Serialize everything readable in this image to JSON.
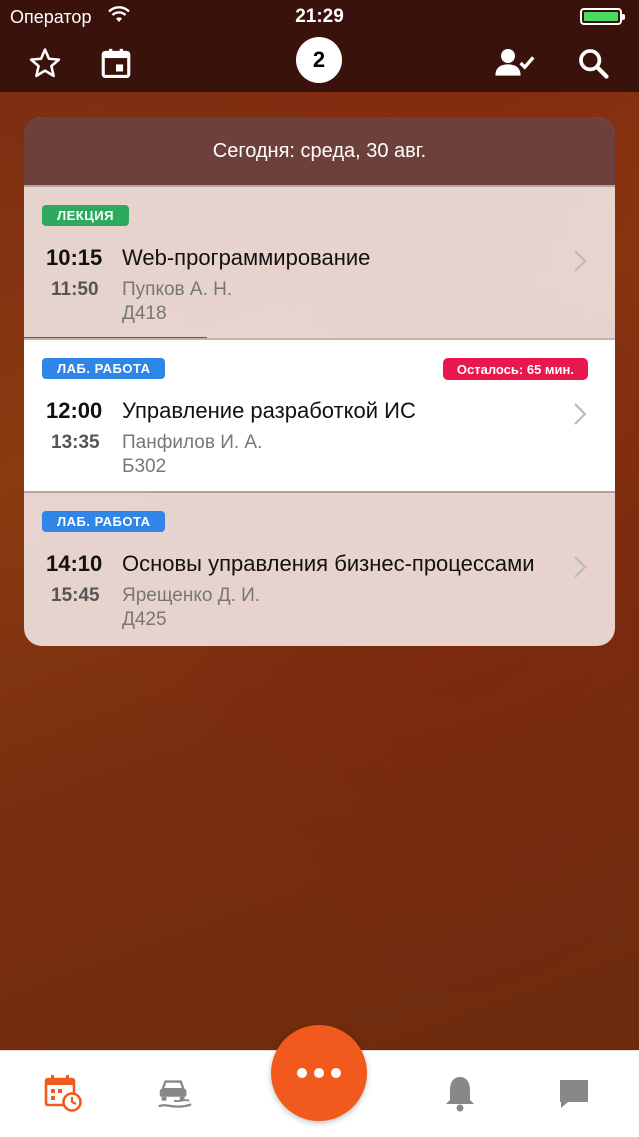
{
  "status_bar": {
    "carrier": "Оператор",
    "time": "21:29"
  },
  "top_nav": {
    "badge_count": "2"
  },
  "header": {
    "today_label": "Сегодня: среда, 30 авг."
  },
  "lessons": [
    {
      "type": "ЛЕКЦИЯ",
      "start": "10:15",
      "end": "11:50",
      "subject": "Web-программирование",
      "teacher": "Пупков А. Н.",
      "room": "Д418"
    },
    {
      "type": "ЛАБ. РАБОТА",
      "start": "12:00",
      "end": "13:35",
      "subject": "Управление разработкой ИС",
      "teacher": "Панфилов И. А.",
      "room": "Б302",
      "remaining": "Осталось: 65 мин."
    },
    {
      "type": "ЛАБ. РАБОТА",
      "start": "14:10",
      "end": "15:45",
      "subject": "Основы управления бизнес-процессами",
      "teacher": "Ярещенко Д. И.",
      "room": "Д425"
    }
  ],
  "colors": {
    "accent": "#f25a1d",
    "lecture": "#2eaa5e",
    "lab": "#2f86e6",
    "remaining": "#e8174d"
  }
}
